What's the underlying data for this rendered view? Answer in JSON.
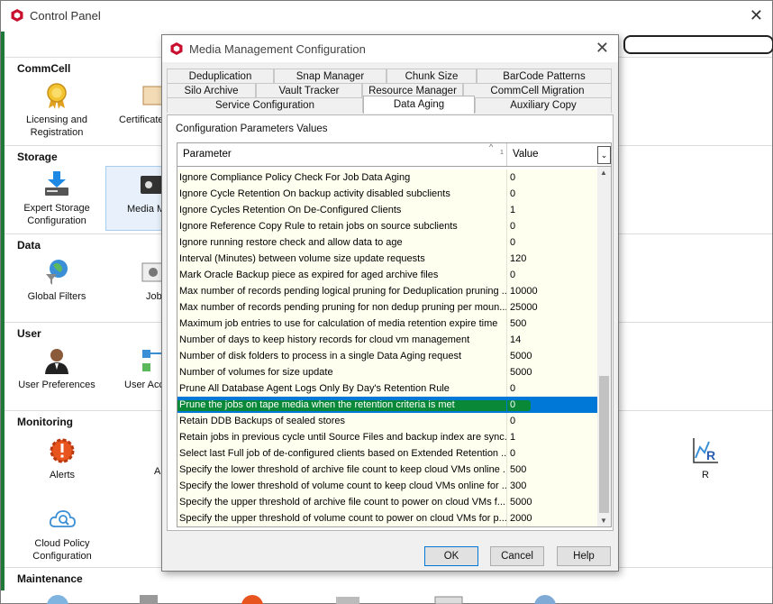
{
  "control_panel": {
    "title": "Control Panel",
    "sections": [
      {
        "title": "CommCell",
        "items": [
          {
            "label": "Licensing and Registration",
            "icon": "license-medal-icon"
          },
          {
            "label": "Certificate Administration",
            "icon": "certificate-icon"
          }
        ]
      },
      {
        "title": "Storage",
        "items": [
          {
            "label": "Expert Storage Configuration",
            "icon": "download-storage-icon"
          },
          {
            "label": "Media Management",
            "icon": "media-management-icon"
          }
        ]
      },
      {
        "title": "Data",
        "items": [
          {
            "label": "Global Filters",
            "icon": "globe-filter-icon"
          },
          {
            "label": "Job Management",
            "icon": "job-management-icon"
          }
        ]
      },
      {
        "title": "User",
        "items": [
          {
            "label": "User Preferences",
            "icon": "user-icon"
          },
          {
            "label": "User Account Management",
            "icon": "users-network-icon"
          }
        ]
      },
      {
        "title": "Monitoring",
        "items": [
          {
            "label": "Alerts",
            "icon": "alert-gear-icon"
          },
          {
            "label": "A",
            "icon": ""
          },
          {
            "label": "R",
            "icon": "r-chart-icon"
          },
          {
            "label": "Cloud Policy Configuration",
            "icon": "cloud-search-icon"
          }
        ]
      },
      {
        "title": "Maintenance",
        "items": []
      }
    ]
  },
  "dialog": {
    "title": "Media Management Configuration",
    "tabs_row1": [
      "Deduplication",
      "Snap Manager",
      "Chunk Size",
      "BarCode Patterns"
    ],
    "tabs_row2": [
      "Silo Archive",
      "Vault Tracker",
      "Resource Manager",
      "CommCell Migration"
    ],
    "tabs_row3": [
      "Service Configuration",
      "Data Aging",
      "Auxiliary Copy"
    ],
    "active_tab": "Data Aging",
    "panel_heading": "Configuration Parameters Values",
    "columns": {
      "parameter": "Parameter",
      "value": "Value",
      "sort_index": "1"
    },
    "rows": [
      {
        "parameter": "Ignore Compliance Policy Check For Job Data Aging",
        "value": "0"
      },
      {
        "parameter": "Ignore Cycle Retention On backup activity disabled subclients",
        "value": "0"
      },
      {
        "parameter": "Ignore Cycles Retention On De-Configured Clients",
        "value": "1"
      },
      {
        "parameter": "Ignore Reference Copy Rule to retain jobs on source subclients",
        "value": "0"
      },
      {
        "parameter": "Ignore running restore check and allow data to age",
        "value": "0"
      },
      {
        "parameter": "Interval (Minutes) between volume size update requests",
        "value": "120"
      },
      {
        "parameter": "Mark Oracle Backup piece as expired for aged archive files",
        "value": "0"
      },
      {
        "parameter": "Max number of records pending logical pruning for Deduplication pruning ...",
        "value": "10000"
      },
      {
        "parameter": "Max number of records pending pruning for non dedup pruning per moun...",
        "value": "25000"
      },
      {
        "parameter": "Maximum job entries to use for calculation of media retention expire time",
        "value": "500"
      },
      {
        "parameter": "Number of days to keep history records for cloud vm management",
        "value": "14"
      },
      {
        "parameter": "Number of disk folders to process in a single Data Aging request",
        "value": "5000"
      },
      {
        "parameter": "Number of volumes for size update",
        "value": "5000"
      },
      {
        "parameter": "Prune All Database Agent Logs Only By Day's Retention Rule",
        "value": "0"
      },
      {
        "parameter": "Prune the jobs on tape media when the retention criteria is met",
        "value": "0"
      },
      {
        "parameter": "Retain DDB Backups of sealed stores",
        "value": "0"
      },
      {
        "parameter": "Retain jobs in previous cycle until Source Files and backup index are sync...",
        "value": "1"
      },
      {
        "parameter": "Select last Full job of de-configured clients based on Extended Retention ...",
        "value": "0"
      },
      {
        "parameter": "Specify the lower threshold of archive file count to keep cloud VMs online ...",
        "value": "500"
      },
      {
        "parameter": "Specify the lower threshold of volume count to keep cloud VMs online for ...",
        "value": "300"
      },
      {
        "parameter": "Specify the upper threshold of archive file count to power on cloud VMs f...",
        "value": "5000"
      },
      {
        "parameter": "Specify the upper threshold of volume count to power on cloud VMs for p...",
        "value": "2000"
      }
    ],
    "selected_row_index": 14,
    "buttons": {
      "ok": "OK",
      "cancel": "Cancel",
      "help": "Help"
    }
  },
  "colors": {
    "selection": "#0078d7",
    "highlight_marker": "#0a8a2a",
    "row_background": "#fffff0",
    "brand_red": "#c8102e"
  }
}
